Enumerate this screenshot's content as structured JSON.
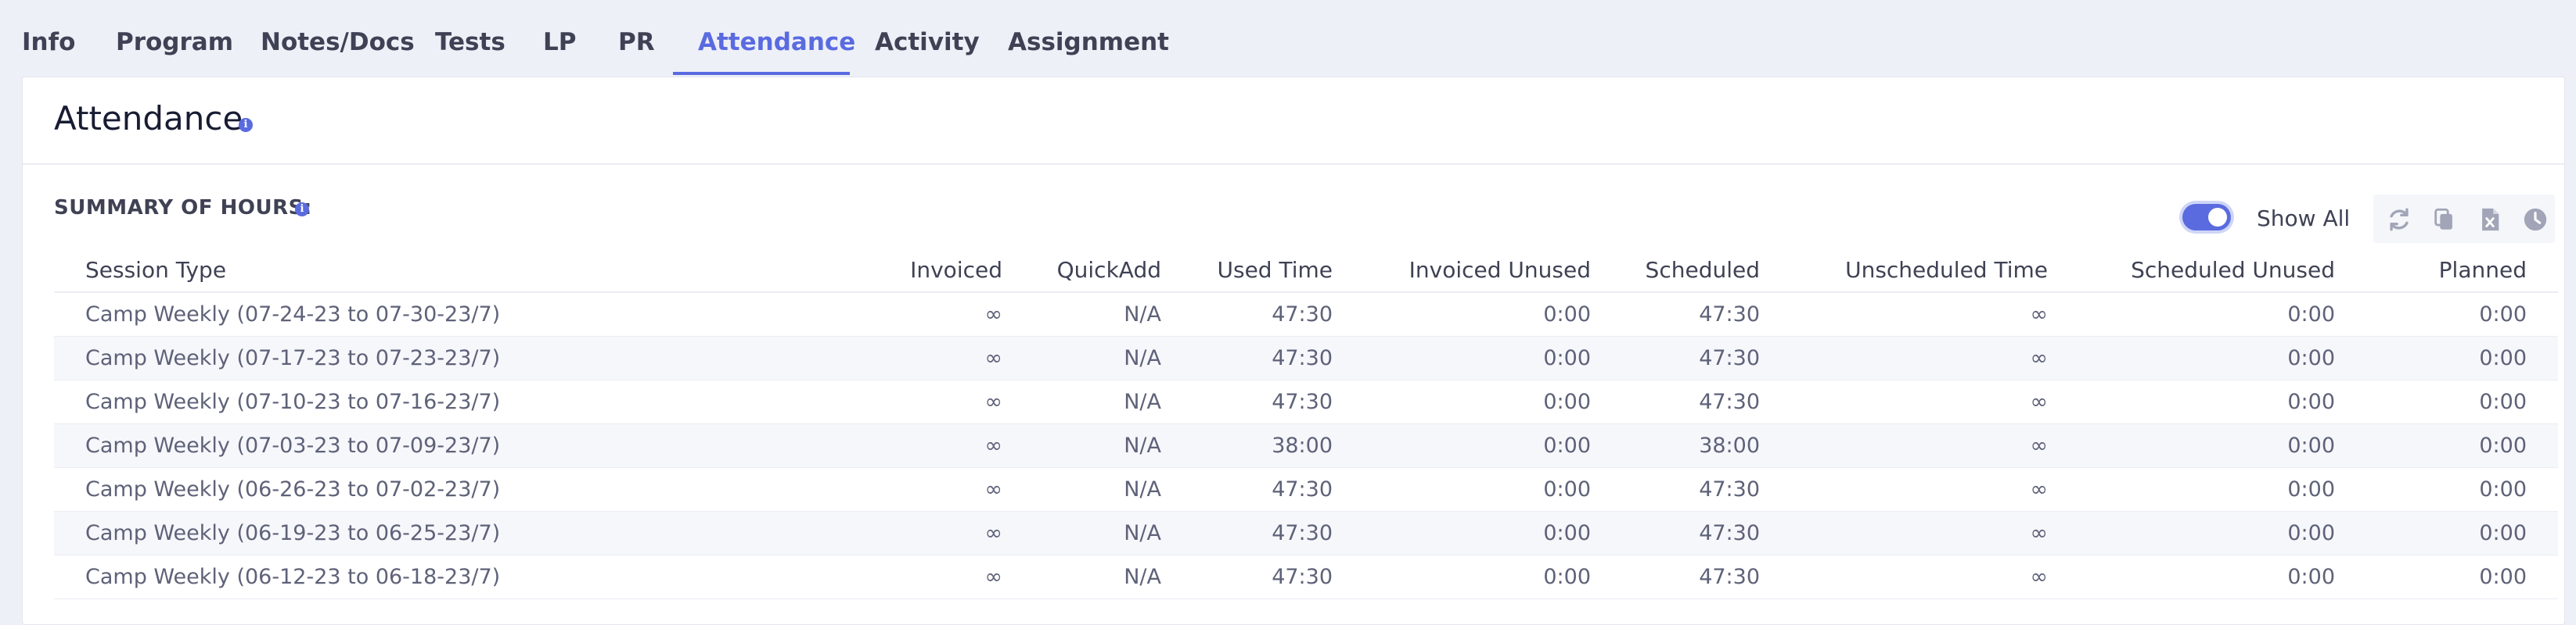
{
  "tabs": [
    {
      "label": "Info",
      "active": false
    },
    {
      "label": "Program",
      "active": false
    },
    {
      "label": "Notes/Docs",
      "active": false
    },
    {
      "label": "Tests",
      "active": false
    },
    {
      "label": "LP",
      "active": false
    },
    {
      "label": "PR",
      "active": false
    },
    {
      "label": "Attendance",
      "active": true
    },
    {
      "label": "Activity",
      "active": false
    },
    {
      "label": "Assignment",
      "active": false
    }
  ],
  "card": {
    "title": "Attendance",
    "info_glyph": "i"
  },
  "summary": {
    "title": "SUMMARY OF HOURS:",
    "show_all_label": "Show All",
    "show_all_on": true,
    "tool_icons": [
      "refresh-icon",
      "copy-icon",
      "excel-export-icon",
      "history-clock-icon"
    ]
  },
  "table": {
    "columns": [
      "Session Type",
      "Invoiced",
      "QuickAdd",
      "Used Time",
      "Invoiced Unused",
      "Scheduled",
      "Unscheduled Time",
      "Scheduled Unused",
      "Planned"
    ],
    "rows": [
      [
        "Camp Weekly (07-24-23 to 07-30-23/7)",
        "∞",
        "N/A",
        "47:30",
        "0:00",
        "47:30",
        "∞",
        "0:00",
        "0:00"
      ],
      [
        "Camp Weekly (07-17-23 to 07-23-23/7)",
        "∞",
        "N/A",
        "47:30",
        "0:00",
        "47:30",
        "∞",
        "0:00",
        "0:00"
      ],
      [
        "Camp Weekly (07-10-23 to 07-16-23/7)",
        "∞",
        "N/A",
        "47:30",
        "0:00",
        "47:30",
        "∞",
        "0:00",
        "0:00"
      ],
      [
        "Camp Weekly (07-03-23 to 07-09-23/7)",
        "∞",
        "N/A",
        "38:00",
        "0:00",
        "38:00",
        "∞",
        "0:00",
        "0:00"
      ],
      [
        "Camp Weekly (06-26-23 to 07-02-23/7)",
        "∞",
        "N/A",
        "47:30",
        "0:00",
        "47:30",
        "∞",
        "0:00",
        "0:00"
      ],
      [
        "Camp Weekly (06-19-23 to 06-25-23/7)",
        "∞",
        "N/A",
        "47:30",
        "0:00",
        "47:30",
        "∞",
        "0:00",
        "0:00"
      ],
      [
        "Camp Weekly (06-12-23 to 06-18-23/7)",
        "∞",
        "N/A",
        "47:30",
        "0:00",
        "47:30",
        "∞",
        "0:00",
        "0:00"
      ]
    ]
  },
  "colors": {
    "accent": "#5a6be0",
    "page_bg": "#eef0f8",
    "card_bg": "#ffffff",
    "row_alt": "#f6f7fb"
  }
}
